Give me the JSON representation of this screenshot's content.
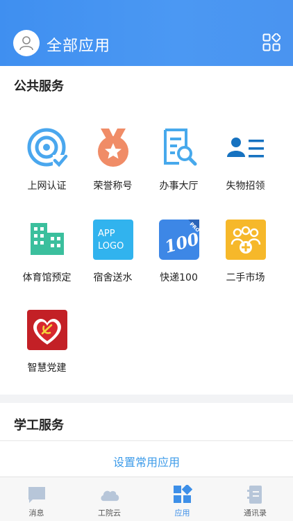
{
  "header": {
    "title": "全部应用"
  },
  "sections": {
    "public": {
      "title": "公共服务",
      "apps": [
        {
          "label": "上网认证",
          "icon": "wifi-auth-icon"
        },
        {
          "label": "荣誉称号",
          "icon": "medal-icon"
        },
        {
          "label": "办事大厅",
          "icon": "document-search-icon"
        },
        {
          "label": "失物招领",
          "icon": "person-list-icon"
        },
        {
          "label": "体育馆预定",
          "icon": "building-icon"
        },
        {
          "label": "宿舍送水",
          "icon": "app-logo-placeholder-icon",
          "icon_text_1": "APP",
          "icon_text_2": "LOGO"
        },
        {
          "label": "快递100",
          "icon": "kuaidi100-icon",
          "icon_text_1": "100",
          "icon_text_2": "PRO"
        },
        {
          "label": "二手市场",
          "icon": "group-add-icon"
        },
        {
          "label": "智慧党建",
          "icon": "party-heart-icon"
        }
      ]
    },
    "student": {
      "title": "学工服务",
      "link": "设置常用应用"
    }
  },
  "tabbar": {
    "items": [
      {
        "label": "消息",
        "icon": "message-icon"
      },
      {
        "label": "工院云",
        "icon": "cloud-icon"
      },
      {
        "label": "应用",
        "icon": "apps-icon",
        "active": true
      },
      {
        "label": "通讯录",
        "icon": "contacts-icon"
      }
    ]
  },
  "colors": {
    "header": "#4a94f0",
    "accent": "#3d8fe8",
    "link": "#3d9be9"
  }
}
